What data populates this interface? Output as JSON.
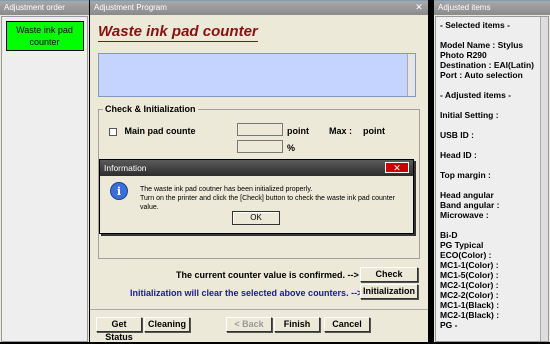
{
  "left": {
    "title": "Adjustment order",
    "items": [
      {
        "line1": "Waste ink pad",
        "line2": "counter"
      }
    ]
  },
  "main": {
    "title": "Adjustment Program",
    "heading": "Waste ink pad counter",
    "group_label": "Check & Initialization",
    "main_pad_label": "Main pad counte",
    "unit_point": "point",
    "max_label": "Max :",
    "max_unit": "point",
    "percent": "%",
    "confirm_text": "The current counter value is confirmed. -->",
    "init_text": "Initialization will clear the selected above counters. -->",
    "check_button": "Check",
    "init_button": "Initialization",
    "bottom_buttons": {
      "get_status": "Get Status",
      "cleaning": "Cleaning",
      "back": "< Back",
      "finish": "Finish",
      "cancel": "Cancel"
    }
  },
  "dialog": {
    "title": "Information",
    "close": "✕",
    "line1": "The waste ink pad coutner has been initialized properly.",
    "line2": "Turn on the printer and click the [Check] button to check the waste ink pad counter value.",
    "ok": "OK"
  },
  "right": {
    "title": "Adjusted items",
    "lines": [
      "- Selected items -",
      "",
      "Model Name : Stylus",
      "Photo R290",
      "Destination : EAI(Latin)",
      "Port : Auto selection",
      "",
      "- Adjusted items -",
      "",
      "Initial Setting :",
      "",
      "USB ID :",
      "",
      "Head ID :",
      "",
      "Top margin :",
      "",
      "Head angular",
      "Band angular :",
      "Microwave :",
      "",
      "Bi-D",
      "PG Typical",
      "  ECO(Color)  :",
      "  MC1-1(Color) :",
      "  MC1-5(Color) :",
      "  MC2-1(Color) :",
      "  MC2-2(Color) :",
      "  MC1-1(Black) :",
      "  MC2-1(Black) :",
      "PG -"
    ]
  },
  "colors": {
    "accent_green": "#00ff00",
    "heading_red": "#8b1010",
    "link_blue": "#1a1a9c",
    "info_box": "#c4d3ff"
  }
}
